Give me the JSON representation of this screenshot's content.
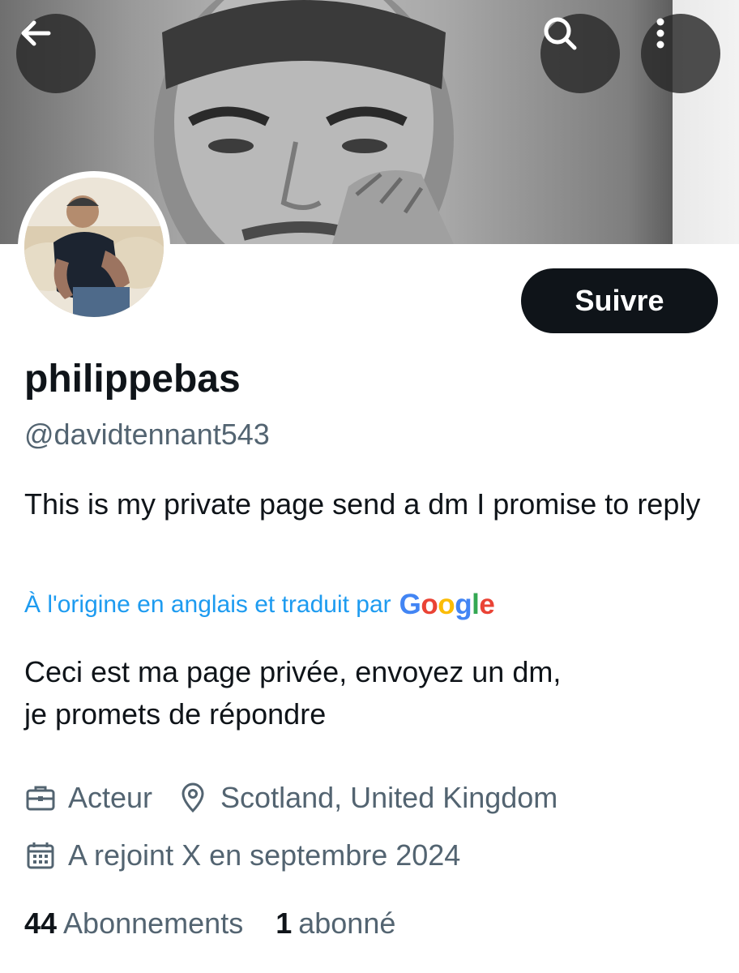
{
  "profile": {
    "display_name": "philippebas",
    "handle": "@davidtennant543",
    "bio": "This is my private page send a dm I promise to reply",
    "translation_note": "À l'origine en anglais et traduit par",
    "translation_provider": "Google",
    "bio_translated_line1": "Ceci est ma page privée, envoyez un dm,",
    "bio_translated_line2": "je promets de répondre",
    "profession": "Acteur",
    "location": "Scotland, United Kingdom",
    "joined": "A rejoint X en septembre 2024"
  },
  "actions": {
    "follow_label": "Suivre"
  },
  "stats": {
    "following_count": "44",
    "following_label": "Abonnements",
    "followers_count": "1",
    "followers_label": "abonné"
  },
  "icons": {
    "back": "arrow-left-icon",
    "search": "search-icon",
    "more": "more-vertical-icon",
    "profession": "briefcase-icon",
    "location": "location-pin-icon",
    "joined": "calendar-icon"
  },
  "colors": {
    "text_primary": "#0f1419",
    "text_secondary": "#536471",
    "link": "#1d9bf0",
    "button_bg": "#0f1419",
    "google_blue": "#4285f4",
    "google_red": "#ea4335",
    "google_yellow": "#fbbc05",
    "google_green": "#34a853"
  }
}
